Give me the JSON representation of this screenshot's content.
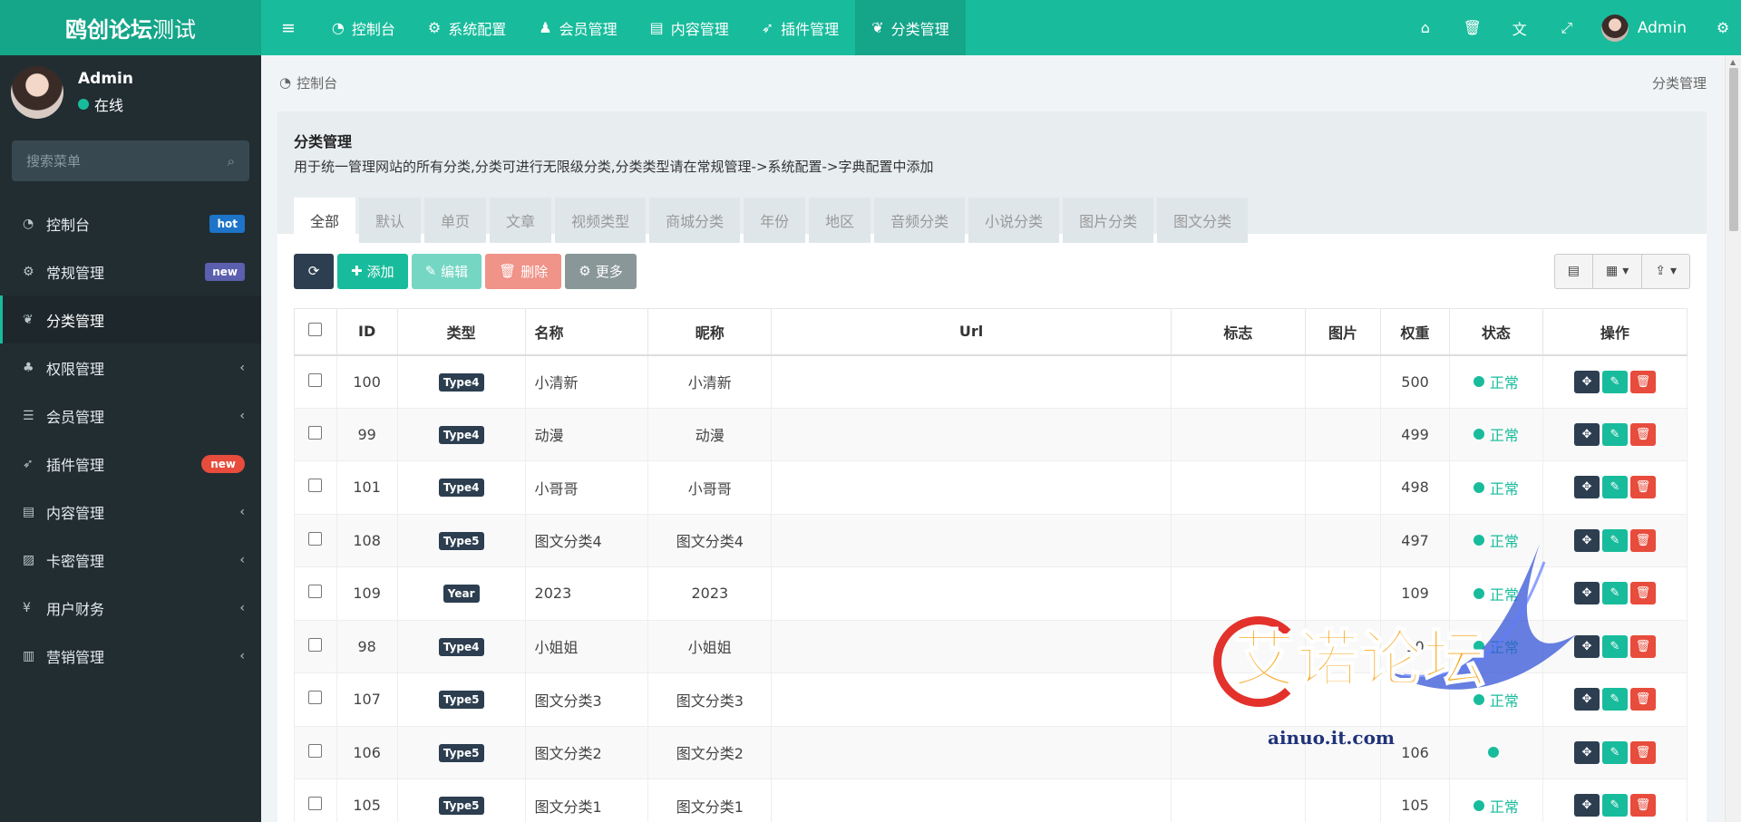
{
  "header": {
    "logo_bold": "鸥创论坛",
    "logo_light": "测试",
    "nav": [
      {
        "icon": "dashboard-icon",
        "glyph": "◔",
        "label": "控制台"
      },
      {
        "icon": "gear-icon",
        "glyph": "⚙",
        "label": "系统配置"
      },
      {
        "icon": "user-icon",
        "glyph": "♟",
        "label": "会员管理"
      },
      {
        "icon": "file-icon",
        "glyph": "▤",
        "label": "内容管理"
      },
      {
        "icon": "rocket-icon",
        "glyph": "➶",
        "label": "插件管理"
      },
      {
        "icon": "leaf-icon",
        "glyph": "❦",
        "label": "分类管理",
        "active": true
      }
    ],
    "user_name": "Admin"
  },
  "sidebar": {
    "user_name": "Admin",
    "status": "在线",
    "search_placeholder": "搜索菜单",
    "items": [
      {
        "label": "控制台",
        "icon": "dashboard-icon",
        "glyph": "◔",
        "badge": "hot"
      },
      {
        "label": "常规管理",
        "icon": "cogs-icon",
        "glyph": "⚙",
        "badge": "new"
      },
      {
        "label": "分类管理",
        "icon": "leaf-icon",
        "glyph": "❦",
        "active": true
      },
      {
        "label": "权限管理",
        "icon": "group-icon",
        "glyph": "♣"
      },
      {
        "label": "会员管理",
        "icon": "list-icon",
        "glyph": "☰"
      },
      {
        "label": "插件管理",
        "icon": "rocket-icon",
        "glyph": "➶",
        "badge": "new"
      },
      {
        "label": "内容管理",
        "icon": "file-icon",
        "glyph": "▤"
      },
      {
        "label": "卡密管理",
        "icon": "image-icon",
        "glyph": "▨"
      },
      {
        "label": "用户财务",
        "icon": "yen-icon",
        "glyph": "¥"
      },
      {
        "label": "营销管理",
        "icon": "bar-chart-icon",
        "glyph": "▥"
      }
    ]
  },
  "breadcrumb": {
    "home": "控制台",
    "current": "分类管理"
  },
  "panel": {
    "title": "分类管理",
    "description": "用于统一管理网站的所有分类,分类可进行无限级分类,分类类型请在常规管理->系统配置->字典配置中添加",
    "tabs": [
      "全部",
      "默认",
      "单页",
      "文章",
      "视频类型",
      "商城分类",
      "年份",
      "地区",
      "音频分类",
      "小说分类",
      "图片分类",
      "图文分类"
    ]
  },
  "toolbar": {
    "add": "添加",
    "edit": "编辑",
    "delete": "删除",
    "more": "更多"
  },
  "table": {
    "headers": [
      "ID",
      "类型",
      "名称",
      "昵称",
      "Url",
      "标志",
      "图片",
      "权重",
      "状态",
      "操作"
    ],
    "rows": [
      {
        "id": "100",
        "type": "Type4",
        "name": "小清新",
        "nickname": "小清新",
        "weight": "500",
        "status": "正常"
      },
      {
        "id": "99",
        "type": "Type4",
        "name": "动漫",
        "nickname": "动漫",
        "weight": "499",
        "status": "正常"
      },
      {
        "id": "101",
        "type": "Type4",
        "name": "小哥哥",
        "nickname": "小哥哥",
        "weight": "498",
        "status": "正常"
      },
      {
        "id": "108",
        "type": "Type5",
        "name": "图文分类4",
        "nickname": "图文分类4",
        "weight": "497",
        "status": "正常"
      },
      {
        "id": "109",
        "type": "Year",
        "name": "2023",
        "nickname": "2023",
        "weight": "109",
        "status": "正常"
      },
      {
        "id": "98",
        "type": "Type4",
        "name": "小姐姐",
        "nickname": "小姐姐",
        "weight": "10",
        "status": "正常"
      },
      {
        "id": "107",
        "type": "Type5",
        "name": "图文分类3",
        "nickname": "图文分类3",
        "weight": "",
        "status": "正常"
      },
      {
        "id": "106",
        "type": "Type5",
        "name": "图文分类2",
        "nickname": "图文分类2",
        "weight": "106",
        "status": ""
      },
      {
        "id": "105",
        "type": "Type5",
        "name": "图文分类1",
        "nickname": "图文分类1",
        "weight": "105",
        "status": "正常"
      }
    ]
  },
  "watermark": {
    "text": "艾诺论坛",
    "url": "ainuo.it.com"
  },
  "colors": {
    "primary": "#18bc9c",
    "dark": "#2c3e50",
    "danger": "#e74c3c",
    "sidebar": "#222d32"
  }
}
